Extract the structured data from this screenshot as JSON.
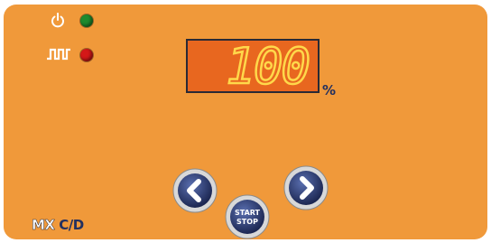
{
  "power_indicator": {
    "icon": "power-icon",
    "led_color": "#1e8a2e"
  },
  "pulse_indicator": {
    "icon": "pulse-wave-icon",
    "led_color": "#d41818"
  },
  "display": {
    "value": "100",
    "unit": "%"
  },
  "controls": {
    "decrease_icon": "chevron-left-icon",
    "increase_icon": "chevron-right-icon",
    "start_stop_line1": "START",
    "start_stop_line2": "STOP"
  },
  "brand": {
    "part1": "MX",
    "part2": "C/D"
  },
  "colors": {
    "panel": "#f0993a",
    "display_bg": "#e8671f",
    "segment": "#ffd84a",
    "button_ring": "#23305f"
  }
}
